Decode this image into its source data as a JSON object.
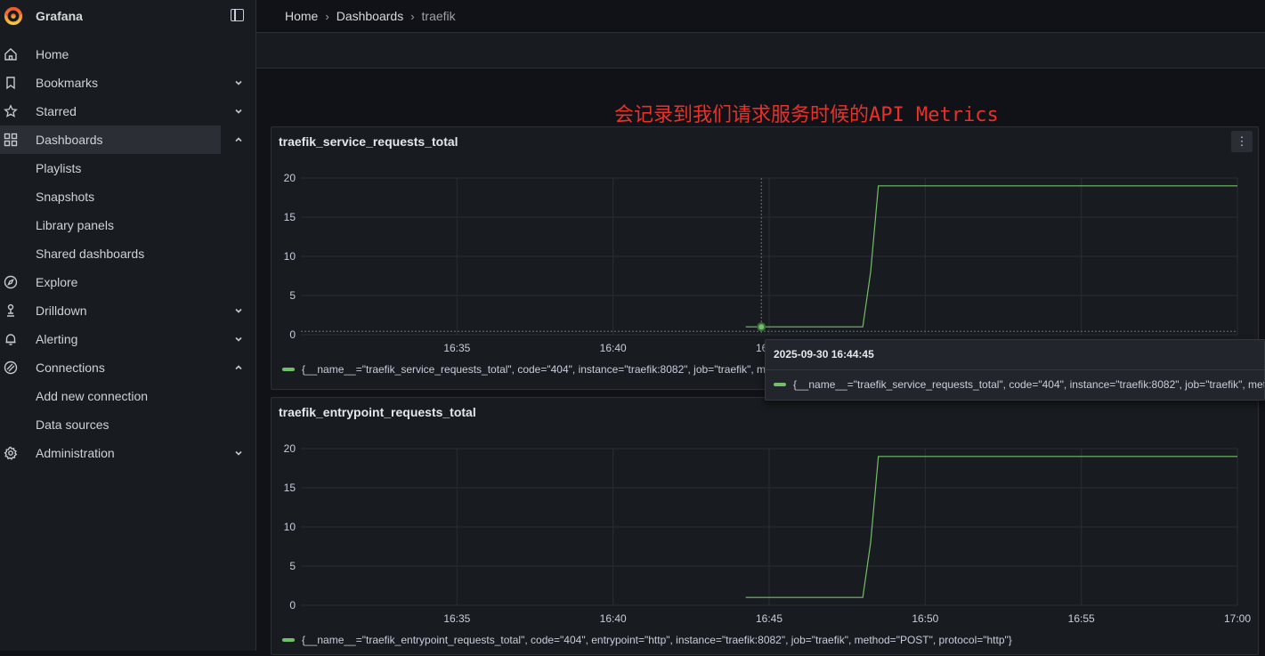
{
  "app": {
    "name": "Grafana"
  },
  "breadcrumb": {
    "home": "Home",
    "dashboards": "Dashboards",
    "current": "traefik",
    "separator": "›"
  },
  "sidebar": {
    "items": [
      {
        "label": "Home",
        "icon": "home-icon"
      },
      {
        "label": "Bookmarks",
        "icon": "bookmark-icon",
        "expandable": true
      },
      {
        "label": "Starred",
        "icon": "star-icon",
        "expandable": true
      },
      {
        "label": "Dashboards",
        "icon": "dashboards-icon",
        "expanded": true,
        "active": true
      },
      {
        "label": "Playlists",
        "sub": true
      },
      {
        "label": "Snapshots",
        "sub": true
      },
      {
        "label": "Library panels",
        "sub": true
      },
      {
        "label": "Shared dashboards",
        "sub": true
      },
      {
        "label": "Explore",
        "icon": "compass-icon"
      },
      {
        "label": "Drilldown",
        "icon": "drilldown-icon",
        "expandable": true
      },
      {
        "label": "Alerting",
        "icon": "bell-icon",
        "expandable": true
      },
      {
        "label": "Connections",
        "icon": "connections-icon",
        "expanded": true
      },
      {
        "label": "Add new connection",
        "sub": true
      },
      {
        "label": "Data sources",
        "sub": true
      },
      {
        "label": "Administration",
        "icon": "gear-icon",
        "expandable": true
      }
    ]
  },
  "annotation": "会记录到我们请求服务时候的API Metrics",
  "colors": {
    "series": "#73bf69",
    "annotation": "#e8312a"
  },
  "panels": [
    {
      "title": "traefik_service_requests_total",
      "legend": "{__name__=\"traefik_service_requests_total\", code=\"404\", instance=\"traefik:8082\", job=\"traefik\", method=\"POST\", protocol=\"http\", service=\"api@internal\"}",
      "menu_icon": "⋮"
    },
    {
      "title": "traefik_entrypoint_requests_total",
      "legend": "{__name__=\"traefik_entrypoint_requests_total\", code=\"404\", entrypoint=\"http\", instance=\"traefik:8082\", job=\"traefik\", method=\"POST\", protocol=\"http\"}"
    }
  ],
  "tooltip": {
    "time": "2025-09-30 16:44:45",
    "series": "{__name__=\"traefik_service_requests_total\", code=\"404\", instance=\"traefik:8082\", job=\"traefik\", method=\"POST\", protocol=\"http\", service=\"api@internal\"}"
  },
  "chart_data": [
    {
      "type": "line",
      "title": "traefik_service_requests_total",
      "x_ticks": [
        "16:35",
        "16:40",
        "16:45",
        "16:50",
        "16:55",
        "17:00"
      ],
      "y_ticks": [
        0,
        5,
        10,
        15,
        20
      ],
      "ylim": [
        0,
        20
      ],
      "xlim": [
        "16:30",
        "17:00"
      ],
      "grid": true,
      "legend": "bottom",
      "series": [
        {
          "name": "{__name__=\"traefik_service_requests_total\", code=\"404\", instance=\"traefik:8082\", job=\"traefik\", method=\"POST\", protocol=\"http\", service=\"api@internal\"}",
          "points": [
            [
              "16:44:15",
              1
            ],
            [
              "16:48:00",
              1
            ],
            [
              "16:48:15",
              8
            ],
            [
              "16:48:30",
              19
            ],
            [
              "17:00:00",
              19
            ]
          ]
        }
      ],
      "hover_point": [
        "16:44:45",
        1
      ]
    },
    {
      "type": "line",
      "title": "traefik_entrypoint_requests_total",
      "x_ticks": [
        "16:35",
        "16:40",
        "16:45",
        "16:50",
        "16:55",
        "17:00"
      ],
      "y_ticks": [
        0,
        5,
        10,
        15,
        20
      ],
      "ylim": [
        0,
        20
      ],
      "xlim": [
        "16:30",
        "17:00"
      ],
      "grid": true,
      "legend": "bottom",
      "series": [
        {
          "name": "{__name__=\"traefik_entrypoint_requests_total\", code=\"404\", entrypoint=\"http\", instance=\"traefik:8082\", job=\"traefik\", method=\"POST\", protocol=\"http\"}",
          "points": [
            [
              "16:44:15",
              1
            ],
            [
              "16:48:00",
              1
            ],
            [
              "16:48:15",
              8
            ],
            [
              "16:48:30",
              19
            ],
            [
              "17:00:00",
              19
            ]
          ]
        }
      ]
    }
  ]
}
